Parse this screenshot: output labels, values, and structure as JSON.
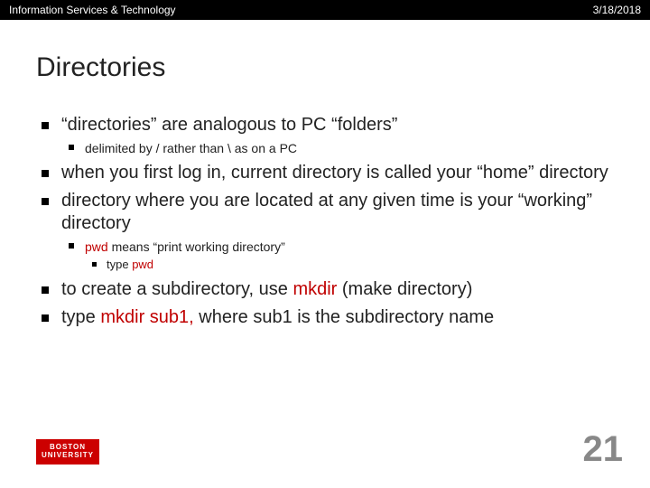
{
  "topbar": {
    "left": "Information Services & Technology",
    "right": "3/18/2018"
  },
  "title": "Directories",
  "bullets": {
    "b1": "“directories” are analogous to PC “folders”",
    "b1a": "delimited by / rather than \\ as on a PC",
    "b2": "when you first log in, current directory is called your “home” directory",
    "b3": "directory where you are located at any given time is your “working” directory",
    "b3a_pre": "pwd",
    "b3a_post": " means “print working directory”",
    "b3a1_pre": "type ",
    "b3a1_cmd": "pwd",
    "b4_pre": "to create a subdirectory, use ",
    "b4_cmd": "mkdir",
    "b4_post": " (make directory)",
    "b5_pre": "type ",
    "b5_cmd": "mkdir sub1,",
    "b5_post": " where sub1 is the subdirectory name"
  },
  "logo": {
    "line1": "BOSTON",
    "line2": "UNIVERSITY"
  },
  "pagenum": "21"
}
